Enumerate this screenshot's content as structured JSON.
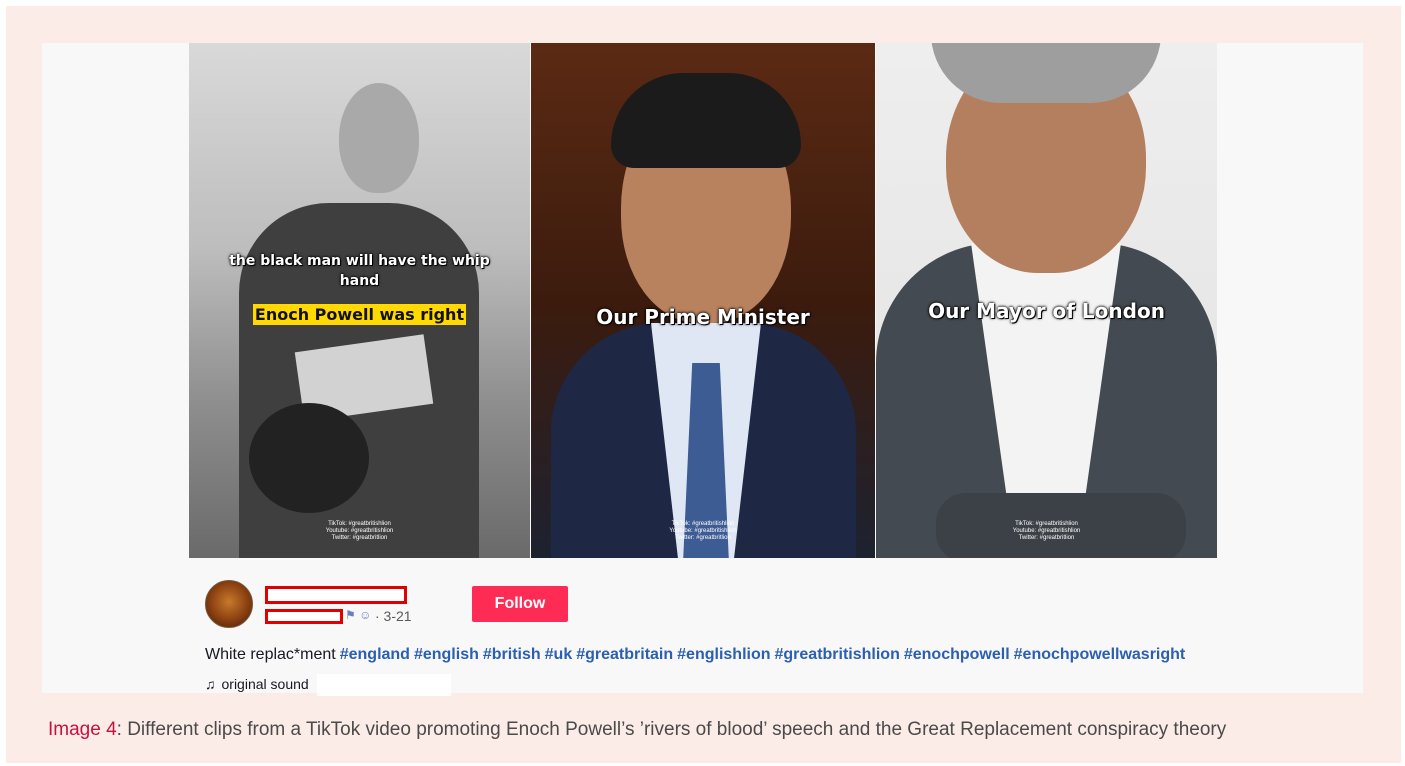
{
  "panels": [
    {
      "caption_small": "the black man will have the whip hand",
      "caption_highlight": "Enoch Powell was right",
      "watermark": "TikTok: #greatbritishlion\nYoutube: #greatbritishlion\nTwitter: #greatbritlion"
    },
    {
      "caption": "Our Prime Minister",
      "watermark": "TikTok: #greatbritishlion\nYoutube: #greatbritishlion\nTwitter: #greatbritlion"
    },
    {
      "caption": "Our Mayor of London",
      "watermark": "TikTok: #greatbritishlion\nYoutube: #greatbritishlion\nTwitter: #greatbritlion"
    }
  ],
  "post": {
    "date": "· 3-21",
    "follow_label": "Follow",
    "description": "White replac*ment",
    "hashtags": [
      "#england",
      "#english",
      "#british",
      "#uk",
      "#greatbritain",
      "#englishlion",
      "#greatbritishlion",
      "#enochpowell",
      "#enochpowellwasright"
    ],
    "sound_icon": "♫",
    "sound": "original sound"
  },
  "caption": {
    "label": "Image 4",
    "text": ": Different clips from a TikTok video promoting Enoch Powell’s ’rivers of blood’ speech and the Great Replacement conspiracy theory"
  },
  "colors": {
    "follow": "#fe2c55",
    "hashtag": "#2b5fb0",
    "caption_label": "#c8103e",
    "highlight": "#ffd900",
    "outer_bg": "#fcece7"
  }
}
